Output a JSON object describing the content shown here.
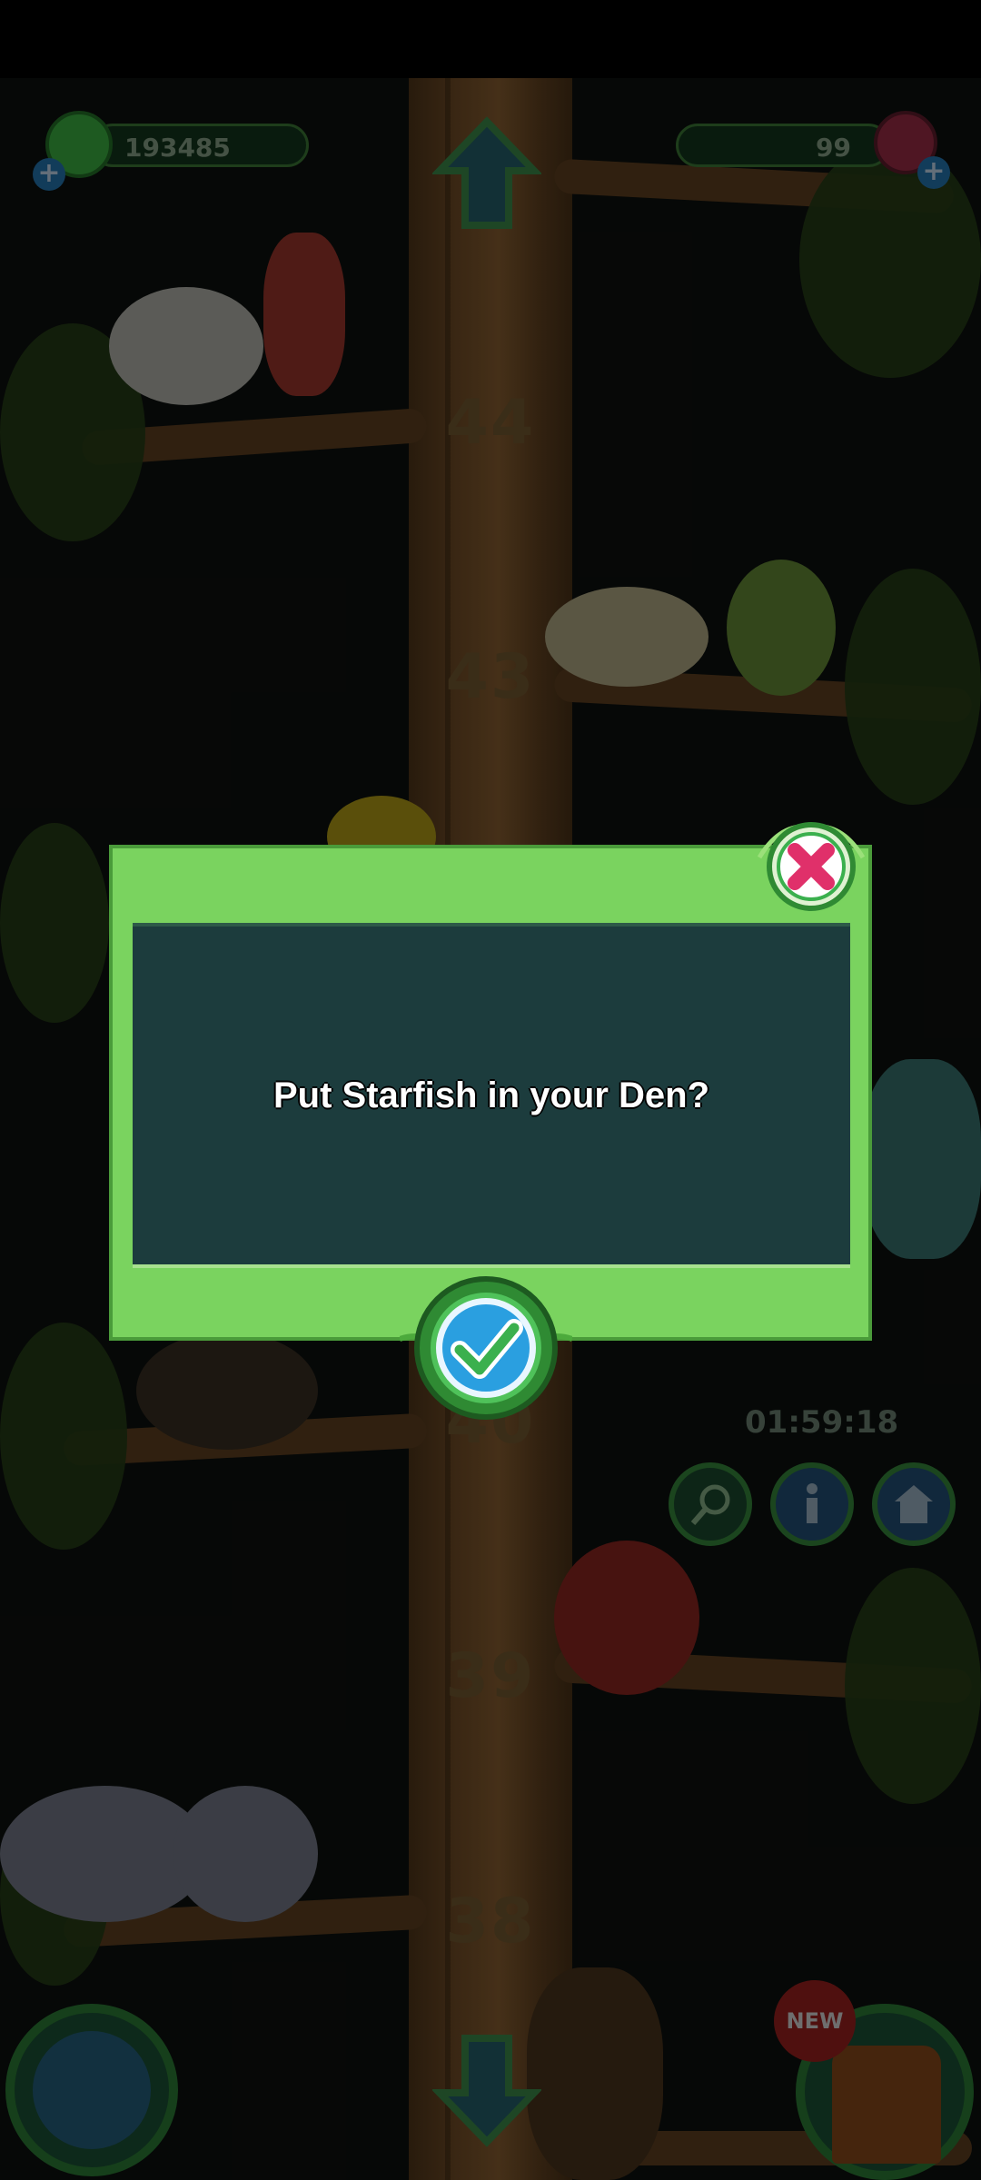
{
  "hud": {
    "gem_count": "193485",
    "premium_count": "99",
    "timer": "01:59:18",
    "new_badge": "NEW"
  },
  "tree": {
    "floors": [
      "44",
      "43",
      "40",
      "39",
      "38"
    ]
  },
  "dialog": {
    "message": "Put Starfish in your Den?"
  },
  "colors": {
    "dialog_frame": "#7ad35f",
    "dialog_panel": "#1c3c3d",
    "close_accent": "#e0306a",
    "confirm_accent": "#2a9fe0"
  },
  "icons": {
    "gem": "green-gem-icon",
    "premium": "red-crystal-icon",
    "up": "up-arrow-icon",
    "down": "down-arrow-icon",
    "net": "net-icon",
    "info": "info-icon",
    "den": "den-icon",
    "globe": "globe-icon",
    "house": "treehouse-icon",
    "close": "close-icon",
    "confirm": "checkmark-icon"
  }
}
